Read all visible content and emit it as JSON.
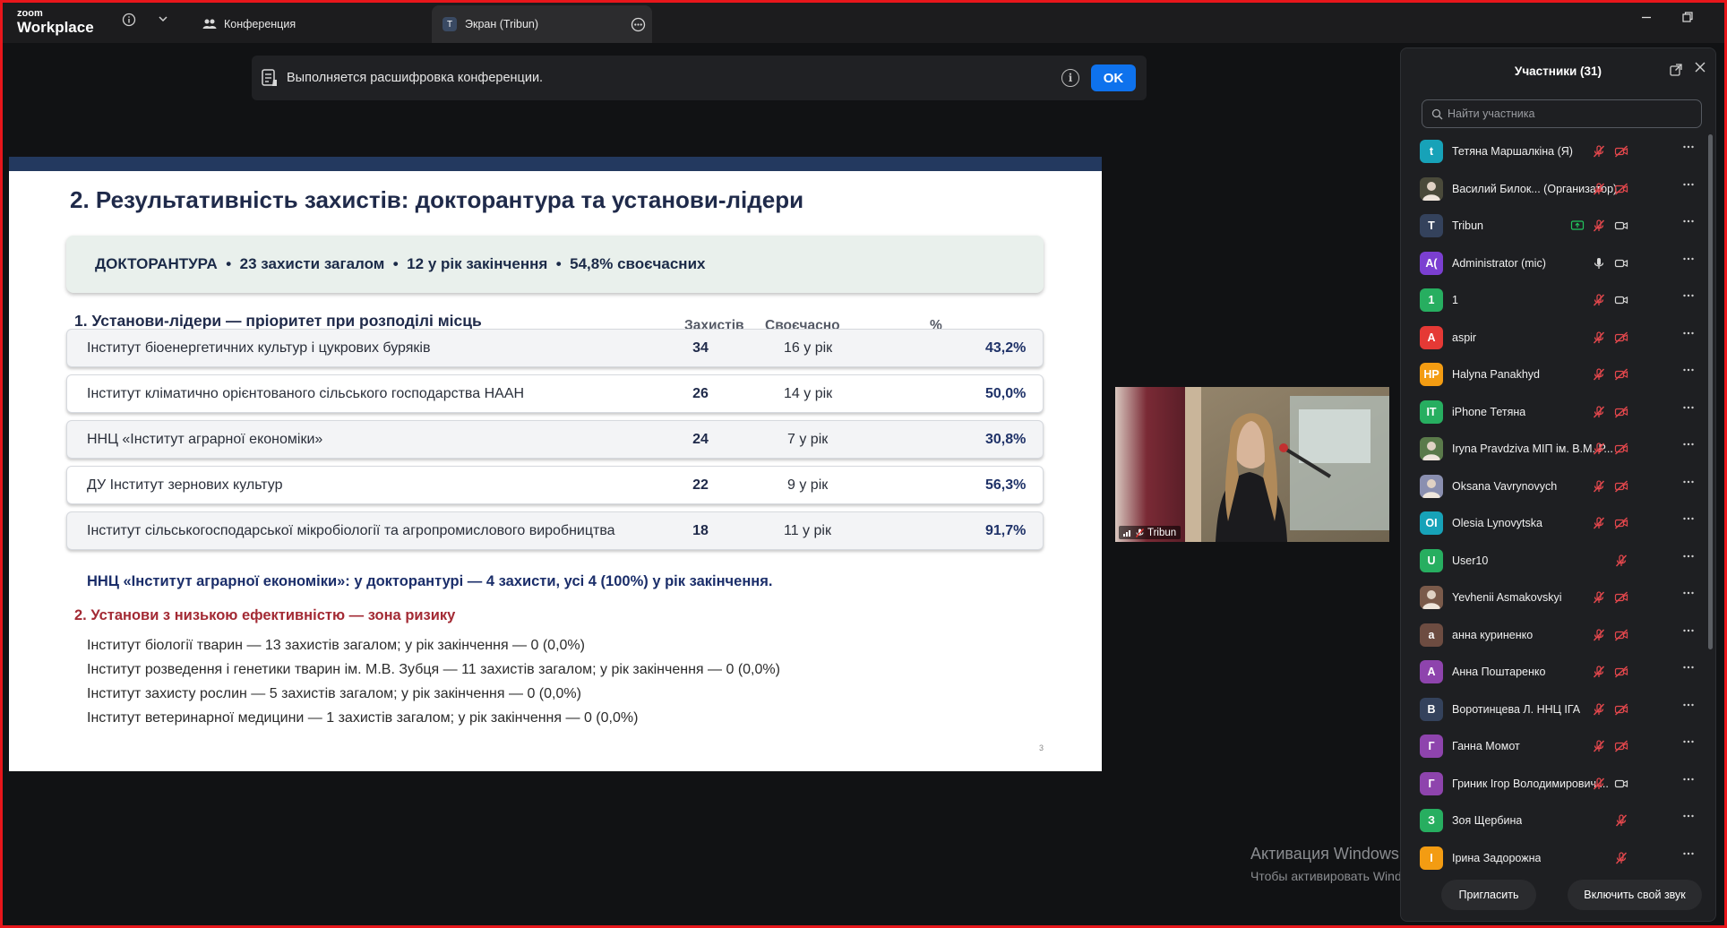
{
  "app": {
    "brand_small": "zoom",
    "brand_large": "Workplace"
  },
  "tabs": [
    {
      "label": "Конференция",
      "badge": ""
    },
    {
      "label": "Экран (Tribun)",
      "badge": "T"
    }
  ],
  "banner": {
    "text": "Выполняется расшифровка конференции.",
    "ok_label": "OK",
    "info_glyph": "i"
  },
  "slide": {
    "title": "2. Результативність захистів: докторантура та установи-лідери",
    "doctorate": "ДОКТОРАНТУРА  •  23 захисти загалом  •  12 у рік закінчення  •  54,8% своєчасних",
    "section1": "1. Установи-лідери — пріоритет при розподілі місць",
    "columns": {
      "defenses": "Захистів",
      "ontime": "Своєчасно",
      "pct": "%"
    },
    "rows": [
      {
        "name": "Інститут біоенергетичних культур і цукрових буряків",
        "defenses": "34",
        "ontime": "16 у рік",
        "pct": "43,2%"
      },
      {
        "name": "Інститут кліматично орієнтованого сільського господарства НААН",
        "defenses": "26",
        "ontime": "14 у рік",
        "pct": "50,0%"
      },
      {
        "name": "ННЦ «Інститут аграрної економіки»",
        "defenses": "24",
        "ontime": "7 у рік",
        "pct": "30,8%"
      },
      {
        "name": "ДУ Інститут зернових культур",
        "defenses": "22",
        "ontime": "9 у рік",
        "pct": "56,3%"
      },
      {
        "name": "Інститут сільськогосподарської мікробіології та агропромислового виробництва",
        "defenses": "18",
        "ontime": "11 у рік",
        "pct": "91,7%"
      }
    ],
    "note": "ННЦ «Інститут аграрної економіки»: у докторантурі — 4 захисти, усі 4 (100%) у рік закінчення.",
    "section2": "2. Установи з низькою ефективністю — зона ризику",
    "risk": [
      "Інститут біології тварин — 13 захистів загалом; у рік закінчення — 0 (0,0%)",
      "Інститут розведення і генетики тварин ім. М.В. Зубця — 11 захистів загалом; у рік закінчення — 0 (0,0%)",
      "Інститут захисту рослин — 5 захистів загалом; у рік закінчення — 0 (0,0%)",
      "Інститут ветеринарної медицини — 1 захистів загалом; у рік закінчення — 0 (0,0%)"
    ],
    "page": "3"
  },
  "video": {
    "name": "Tribun"
  },
  "watermark": {
    "line1": "Активация Windows",
    "line2": "Чтобы активировать Windows, перейдите в раздел \"Параметры\"."
  },
  "participants": {
    "title": "Участники (31)",
    "search_placeholder": "Найти участника",
    "invite_label": "Пригласить",
    "unmute_label": "Включить свой звук",
    "list": [
      {
        "initials": "t",
        "color": "#17a2b8",
        "name": "Тетяна Маршалкіна (Я)",
        "mic": "muted",
        "video": "off"
      },
      {
        "initials": "",
        "color": "#4a4a3a",
        "name": "Василий Билок... (Организатор)",
        "mic": "muted",
        "video": "off"
      },
      {
        "initials": "T",
        "color": "#34425c",
        "name": "Tribun",
        "mic": "muted",
        "video": "on"
      },
      {
        "initials": "A(",
        "color": "#7b3fd1",
        "name": "Administrator (mic)",
        "mic": "on",
        "video": "on"
      },
      {
        "initials": "1",
        "color": "#27ae60",
        "name": "1",
        "mic": "muted",
        "video": "on"
      },
      {
        "initials": "A",
        "color": "#e53935",
        "name": "aspir",
        "mic": "muted",
        "video": "off"
      },
      {
        "initials": "HP",
        "color": "#f39c12",
        "name": "Halyna Panakhyd",
        "mic": "muted",
        "video": "off"
      },
      {
        "initials": "IT",
        "color": "#27ae60",
        "name": "iPhone Тетяна",
        "mic": "muted",
        "video": "off"
      },
      {
        "initials": "",
        "color": "#5a7a4a",
        "name": "Iryna Pravdziva МІП ім. В.М. Р...",
        "mic": "muted",
        "video": "off"
      },
      {
        "initials": "",
        "color": "#8a8fb0",
        "name": "Oksana Vavrynovych",
        "mic": "muted",
        "video": "off"
      },
      {
        "initials": "OI",
        "color": "#17a2b8",
        "name": "Olesia Lynovytska",
        "mic": "muted",
        "video": "off"
      },
      {
        "initials": "U",
        "color": "#27ae60",
        "name": "User10",
        "mic": "muted",
        "video": "none"
      },
      {
        "initials": "",
        "color": "#7a5a4a",
        "name": "Yevhenii Asmakovskyi",
        "mic": "muted",
        "video": "off"
      },
      {
        "initials": "а",
        "color": "#6d4c41",
        "name": "анна куриненко",
        "mic": "muted",
        "video": "off"
      },
      {
        "initials": "А",
        "color": "#8e44ad",
        "name": "Анна Поштаренко",
        "mic": "muted",
        "video": "off"
      },
      {
        "initials": "В",
        "color": "#34425c",
        "name": "Воротинцева Л. ННЦ ІГА",
        "mic": "muted",
        "video": "off"
      },
      {
        "initials": "Г",
        "color": "#8e44ad",
        "name": "Ганна Момот",
        "mic": "muted",
        "video": "off"
      },
      {
        "initials": "Г",
        "color": "#8e44ad",
        "name": "Гриник Ігор Володимирович ...",
        "mic": "muted",
        "video": "on"
      },
      {
        "initials": "З",
        "color": "#27ae60",
        "name": "Зоя Щербина",
        "mic": "muted",
        "video": "none"
      },
      {
        "initials": "І",
        "color": "#f39c12",
        "name": "Ірина Задорожна",
        "mic": "muted",
        "video": "none"
      }
    ]
  }
}
